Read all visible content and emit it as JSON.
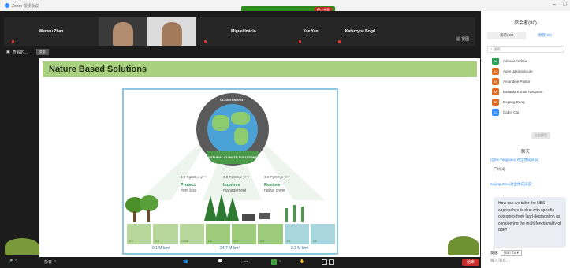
{
  "window": {
    "title": "Zoom 视频会议",
    "share_stop": "停止共享"
  },
  "gallery": {
    "participants": [
      {
        "name": "Wenwu Zhao"
      },
      {
        "name": ""
      },
      {
        "name": ""
      },
      {
        "name": "Miguel Inácio"
      },
      {
        "name": "Yue Yan"
      },
      {
        "name": "Katarzyna Bogd..."
      }
    ],
    "view_label": "视图"
  },
  "sharer": {
    "label": "查看的...",
    "view_btn": "查看"
  },
  "slide": {
    "title": "Nature Based Solutions",
    "globe_top": "CLEAN ENERGY",
    "globe_bottom": "NATURAL CLIMATE SOLUTIONS",
    "categories": [
      {
        "value": "3.9 PgCO₂e yr⁻¹",
        "l1": "Protect",
        "l2": "from loss"
      },
      {
        "value": "3.8 PgCO₂e yr⁻¹",
        "l1": "Improve",
        "l2": "management"
      },
      {
        "value": "3.6 PgCO₂e yr⁻¹",
        "l1": "Restore",
        "l2": "native cover"
      }
    ],
    "col_values": [
      "3.0",
      "0.5",
      "0.008",
      "1.3",
      "1.9",
      "0.5",
      "3.0",
      "0.5"
    ],
    "totals": [
      "0.1 M km²",
      "24.7 M km²",
      "2.3 M km²"
    ]
  },
  "toolbar": {
    "left": "静音",
    "right": "结束"
  },
  "panel": {
    "title": "参会者(80)",
    "tab_all": "邀请(80)",
    "tab_waiting": "静音(80)",
    "search": "搜索",
    "participants": [
      {
        "initials": "AA",
        "name": "Adriana Alebsa",
        "color": "#2ca05a"
      },
      {
        "initials": "AJ",
        "name": "Agne Jasinaviciute",
        "color": "#e06b1f"
      },
      {
        "initials": "AP",
        "name": "Amandine Pastor",
        "color": "#e06b1f"
      },
      {
        "initials": "BK",
        "name": "Basanta Kumar Neupane",
        "color": "#e06b1f"
      },
      {
        "initials": "BD",
        "name": "Bogang Dong",
        "color": "#e06b1f"
      },
      {
        "initials": "CC",
        "name": "Cabot Cai",
        "color": "#2d8cff"
      }
    ],
    "mute_all": "全部静音",
    "chat_title": "聊天",
    "chat_line1": "(Qihe Yangxiao) 对全体成员说:",
    "chat_msg1": "广州(d)",
    "chat_line2": "Kaijing Zhou对全体成员说:",
    "chat_bubble": "How can we tailor the NBS approaches to deal with specific outcomes from land degradation as considering the multi-functionality of BGI?",
    "send_to": "发送:",
    "send_to_value": "Nan Eu ▾",
    "input_placeholder": "输入消息..."
  }
}
